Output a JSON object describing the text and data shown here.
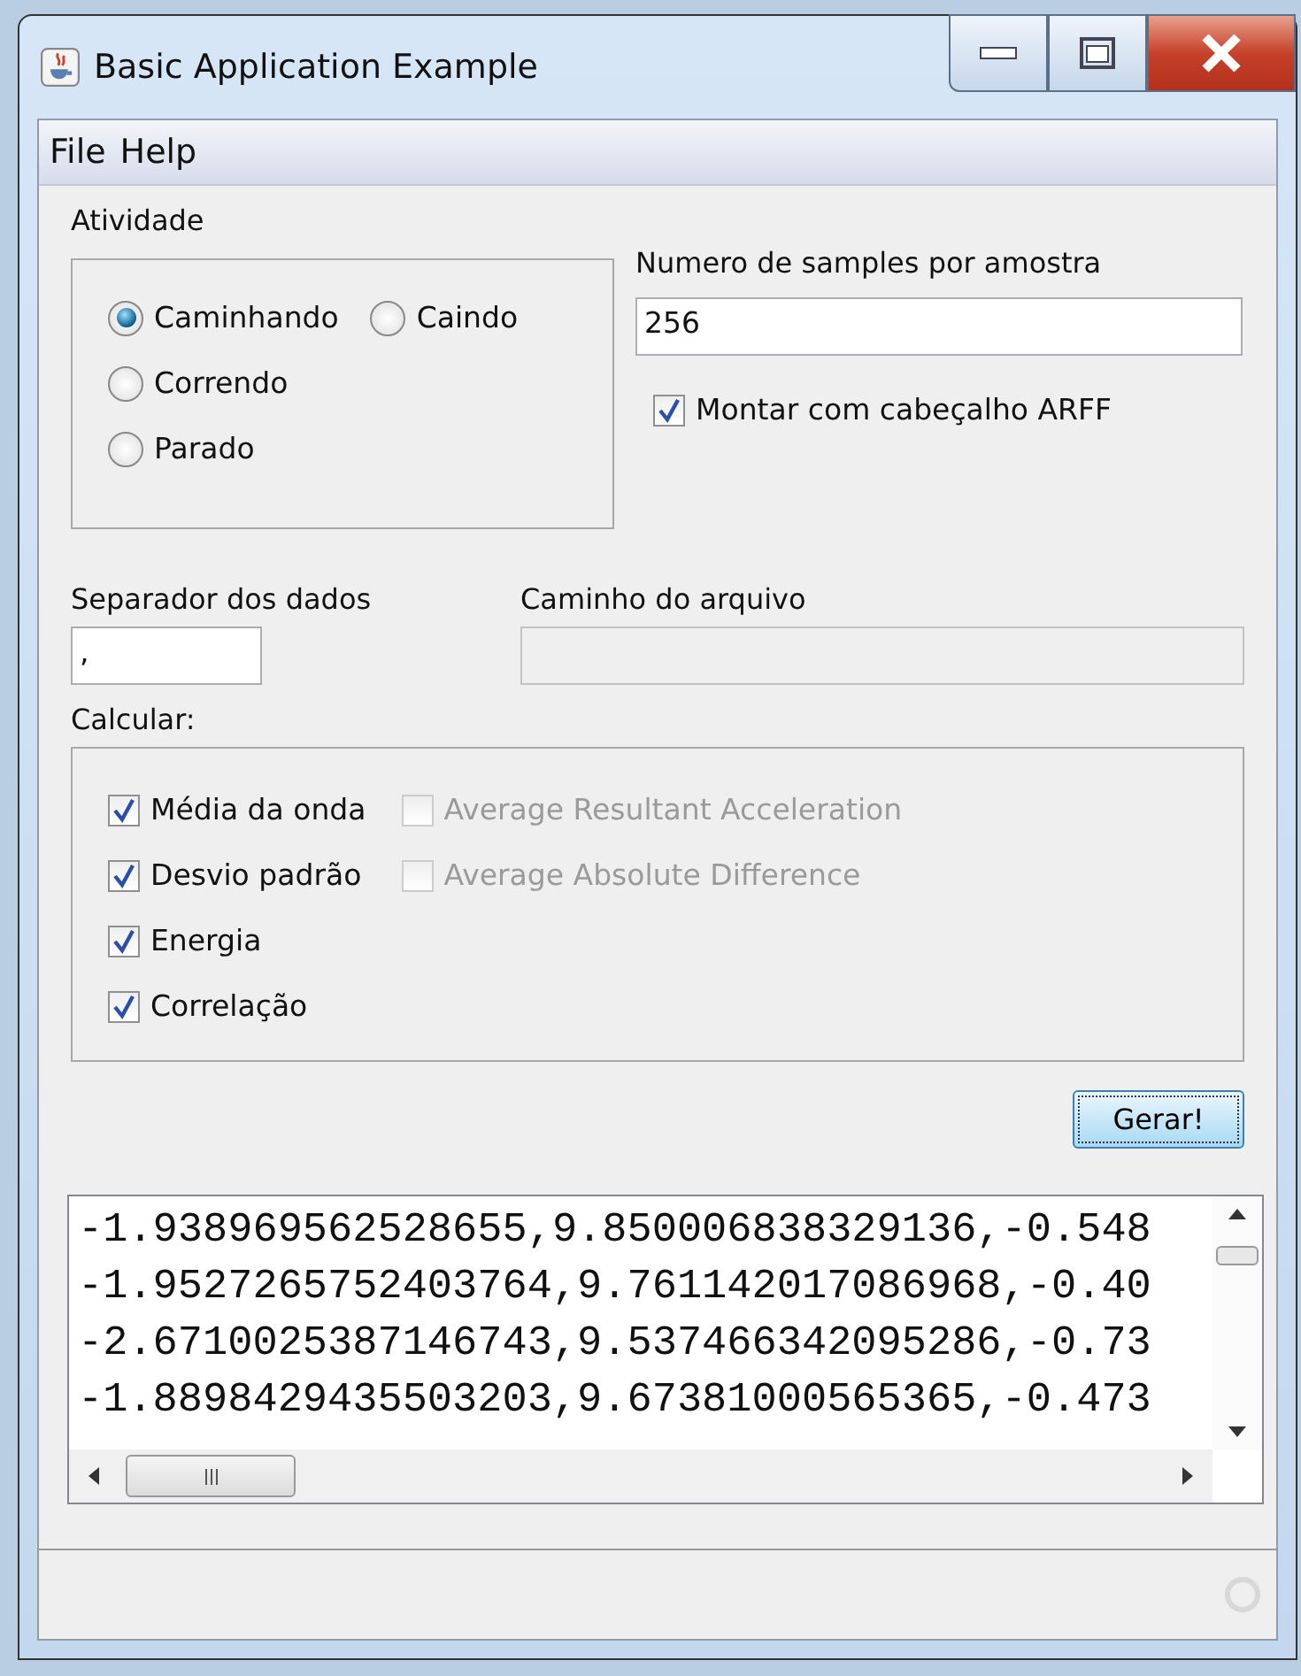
{
  "window": {
    "title": "Basic Application Example"
  },
  "menu": [
    "File",
    "Help"
  ],
  "activity": {
    "label": "Atividade",
    "options": [
      {
        "label": "Caminhando",
        "selected": true
      },
      {
        "label": "Correndo",
        "selected": false
      },
      {
        "label": "Parado",
        "selected": false
      },
      {
        "label": "Caindo",
        "selected": false
      }
    ]
  },
  "samples": {
    "label": "Numero de samples por amostra",
    "value": "256"
  },
  "arff": {
    "label": "Montar com cabeçalho ARFF",
    "checked": true
  },
  "separator": {
    "label": "Separador dos dados",
    "value": ","
  },
  "path": {
    "label": "Caminho do arquivo",
    "disabled": true
  },
  "calc": {
    "label": "Calcular:",
    "options": [
      {
        "label": "Média da onda",
        "checked": true,
        "disabled": false
      },
      {
        "label": "Desvio padrão",
        "checked": true,
        "disabled": false
      },
      {
        "label": "Energia",
        "checked": true,
        "disabled": false
      },
      {
        "label": "Correlação",
        "checked": true,
        "disabled": false
      },
      {
        "label": "Average Resultant Acceleration",
        "checked": false,
        "disabled": true
      },
      {
        "label": "Average Absolute Difference",
        "checked": false,
        "disabled": true
      }
    ]
  },
  "generate_button": "Gerar!",
  "output": {
    "lines": [
      "-1.938969562528655,9.850006838329136,-0.548",
      "-1.9527265752403764,9.761142017086968,-0.40",
      "-2.6710025387146743,9.537466342095286,-0.73",
      "-1.8898429435503203,9.67381000565365,-0.473"
    ]
  }
}
